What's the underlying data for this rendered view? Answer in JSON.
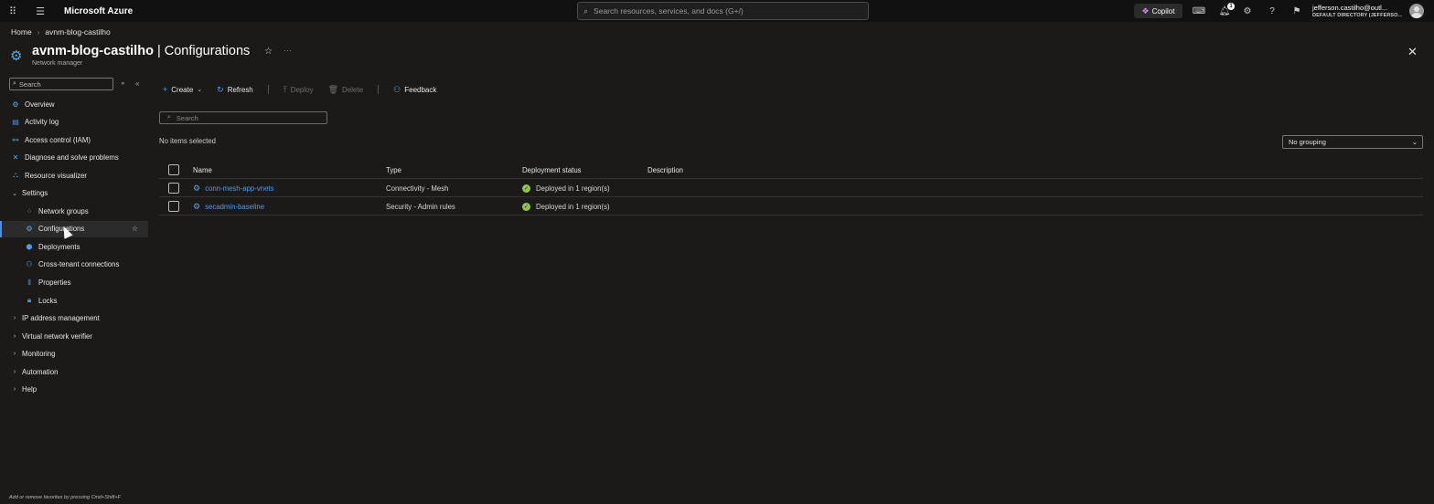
{
  "topbar": {
    "brand": "Microsoft Azure",
    "search_placeholder": "Search resources, services, and docs (G+/)",
    "copilot_label": "Copilot",
    "notification_count": "1",
    "account_user": "jefferson.castilho@outl...",
    "account_directory": "DEFAULT DIRECTORY (JEFFERSO..."
  },
  "breadcrumb": [
    "Home",
    "avnm-blog-castilho"
  ],
  "resource": {
    "name": "avnm-blog-castilho",
    "separator": " | ",
    "page": "Configurations",
    "type": "Network manager"
  },
  "sidebar": {
    "search_placeholder": "Search",
    "items": [
      {
        "label": "Overview",
        "icon": "overview-icon",
        "glyph": "⚙",
        "color": "#5aa9e6",
        "indent": 0
      },
      {
        "label": "Activity log",
        "icon": "activity-log-icon",
        "glyph": "▤",
        "color": "#4f8fdc",
        "indent": 0
      },
      {
        "label": "Access control (IAM)",
        "icon": "access-control-icon",
        "glyph": "⚯",
        "color": "#5aa9e6",
        "indent": 0
      },
      {
        "label": "Diagnose and solve problems",
        "icon": "wrench-icon",
        "glyph": "✕",
        "color": "#5aa9e6",
        "indent": 0
      },
      {
        "label": "Resource visualizer",
        "icon": "resource-visualizer-icon",
        "glyph": "⛬",
        "color": "#5aa9e6",
        "indent": 0
      },
      {
        "label": "Settings",
        "icon": "chevron-down-icon",
        "glyph": "⌄",
        "color": "#ccc",
        "indent": 0,
        "group": true
      },
      {
        "label": "Network groups",
        "icon": "network-groups-icon",
        "glyph": "⁘",
        "color": "#9a9a9a",
        "indent": 1
      },
      {
        "label": "Configurations",
        "icon": "configurations-icon",
        "glyph": "⚙",
        "color": "#5aa9e6",
        "indent": 1,
        "active": true
      },
      {
        "label": "Deployments",
        "icon": "deployments-icon",
        "glyph": "⬢",
        "color": "#4f9be8",
        "indent": 1
      },
      {
        "label": "Cross-tenant connections",
        "icon": "cross-tenant-icon",
        "glyph": "⚇",
        "color": "#5aa9e6",
        "indent": 1
      },
      {
        "label": "Properties",
        "icon": "properties-icon",
        "glyph": "⫴",
        "color": "#4f9be8",
        "indent": 1
      },
      {
        "label": "Locks",
        "icon": "lock-icon",
        "glyph": "🔒︎",
        "color": "#4f9be8",
        "indent": 1
      },
      {
        "label": "IP address management",
        "icon": "chevron-right-icon",
        "glyph": "›",
        "color": "#ccc",
        "indent": 0,
        "group": true
      },
      {
        "label": "Virtual network verifier",
        "icon": "chevron-right-icon",
        "glyph": "›",
        "color": "#ccc",
        "indent": 0,
        "group": true
      },
      {
        "label": "Monitoring",
        "icon": "chevron-right-icon",
        "glyph": "›",
        "color": "#ccc",
        "indent": 0,
        "group": true
      },
      {
        "label": "Automation",
        "icon": "chevron-right-icon",
        "glyph": "›",
        "color": "#ccc",
        "indent": 0,
        "group": true
      },
      {
        "label": "Help",
        "icon": "chevron-right-icon",
        "glyph": "›",
        "color": "#ccc",
        "indent": 0,
        "group": true
      }
    ],
    "footer_hint": "Add or remove favorites by pressing Cmd+Shift+F"
  },
  "toolbar": {
    "create_label": "Create",
    "refresh_label": "Refresh",
    "deploy_label": "Deploy",
    "delete_label": "Delete",
    "feedback_label": "Feedback"
  },
  "filter": {
    "search_placeholder": "Search",
    "selection_status": "No items selected",
    "grouping_value": "No grouping"
  },
  "grid": {
    "columns": [
      "Name",
      "Type",
      "Deployment status",
      "Description"
    ],
    "rows": [
      {
        "name": "conn-mesh-app-vnets",
        "type": "Connectivity - Mesh",
        "status": "Deployed in 1 region(s)",
        "description": ""
      },
      {
        "name": "secadmin-baseline",
        "type": "Security - Admin rules",
        "status": "Deployed in 1 region(s)",
        "description": ""
      }
    ]
  }
}
